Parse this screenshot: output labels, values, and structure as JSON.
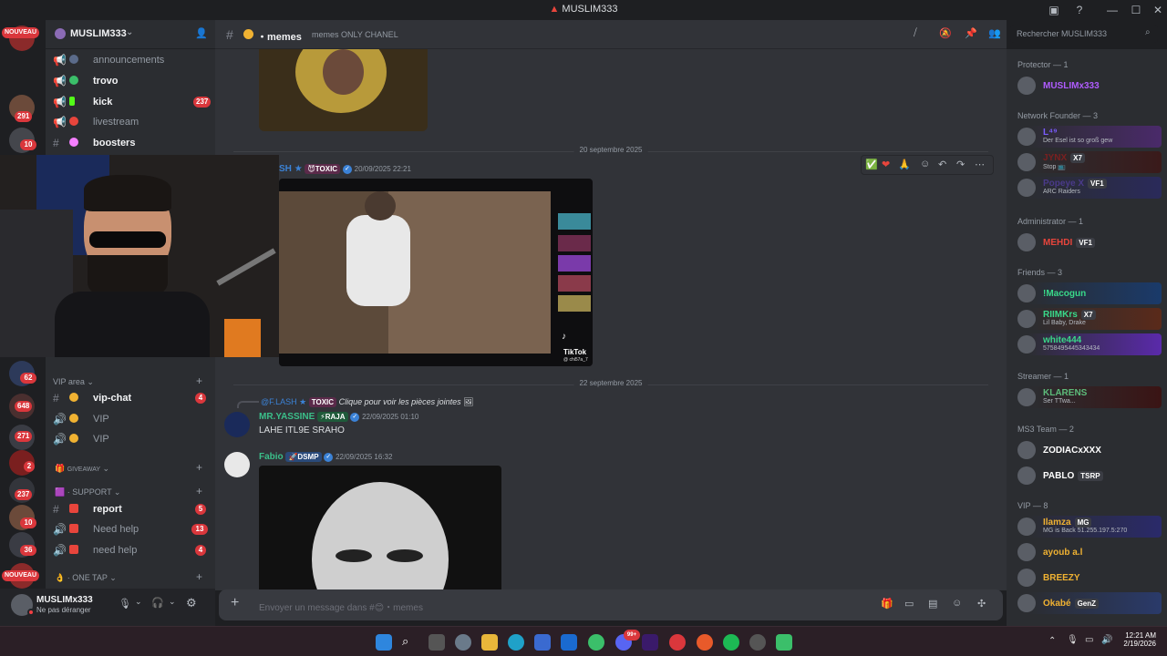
{
  "window": {
    "title": "MUSLIM333",
    "minimize": "—",
    "maximize": "☐",
    "close": "✕"
  },
  "rail": {
    "new_label": "NOUVEAU",
    "badges": [
      "291",
      "10",
      "62",
      "648",
      "271",
      "2",
      "237",
      "10",
      "36"
    ]
  },
  "server": {
    "name": "MUSLIM333"
  },
  "channels": [
    {
      "name": "announcements",
      "icon": "megaphone-icon"
    },
    {
      "name": "trovo",
      "icon": "hash-icon"
    },
    {
      "name": "kick",
      "icon": "megaphone-icon",
      "badge": "237"
    },
    {
      "name": "livestream",
      "icon": "megaphone-icon"
    },
    {
      "name": "boosters",
      "icon": "hash-icon"
    }
  ],
  "vip_area": {
    "label": "VIP area",
    "channels": [
      {
        "name": "vip-chat",
        "badge": "4"
      },
      {
        "name": "VIP"
      },
      {
        "name": "VIP"
      }
    ]
  },
  "giveaway_label": "GIVEAWAY",
  "support": {
    "label": "SUPPORT",
    "channels": [
      {
        "name": "report",
        "badge": "5"
      },
      {
        "name": "Need help",
        "badge": "13"
      },
      {
        "name": "need help",
        "badge": "4"
      }
    ]
  },
  "one_tap_label": "ONE TAP",
  "user": {
    "name": "MUSLIMx333",
    "status": "Ne pas déranger"
  },
  "chat_header": {
    "channel": "memes",
    "topic": "memes ONLY CHANEL",
    "search_placeholder": "Rechercher MUSLIM333"
  },
  "messages": {
    "date1": "20 septembre 2025",
    "msg1": {
      "author": "SH",
      "tag": "TOXIC",
      "time": "20/09/2025 22:21",
      "tiktok_label": "TikTok",
      "tiktok_handle": "@ chi57a_7"
    },
    "date2": "22 septembre 2025",
    "reply": {
      "author": "@F.LASH",
      "tag": "TOXIC",
      "text": "Clique pour voir les pièces jointes"
    },
    "msg2": {
      "author": "MR.YASSINE",
      "tag": "RAJA",
      "time": "22/09/2025 01:10",
      "text": "LAHE ITL9E SRAHO"
    },
    "msg3": {
      "author": "Fabio",
      "tag": "DSMP",
      "time": "22/09/2025 16:32"
    }
  },
  "composer": {
    "placeholder": "Envoyer un message dans #😊・memes"
  },
  "members": {
    "protector": {
      "label": "Protector — 1",
      "items": [
        {
          "name": "MUSLIMx333",
          "color": "#b05cff"
        }
      ]
    },
    "founder": {
      "label": "Network Founder — 3",
      "items": [
        {
          "name": "L⁴⁹",
          "sub": "Der Esel ist so groß gew",
          "color": "#7a5cff"
        },
        {
          "name": "JYNX",
          "tag": "X7",
          "sub": "Stop 📺",
          "color": "#7a2020"
        },
        {
          "name": "Popeye X",
          "tag": "VF1",
          "sub": "ARC Raiders",
          "color": "#4a3a8a"
        }
      ]
    },
    "admin": {
      "label": "Administrator — 1",
      "items": [
        {
          "name": "MEHDI",
          "tag": "VF1",
          "color": "#e8453c"
        }
      ]
    },
    "friends": {
      "label": "Friends — 3",
      "items": [
        {
          "name": "!Macogun",
          "color": "#39d98a"
        },
        {
          "name": "RIIMKrs",
          "tag": "X7",
          "sub": "Lil Baby, Drake",
          "color": "#39d98a"
        },
        {
          "name": "white444",
          "sub": "5758495445343434",
          "color": "#39d98a"
        }
      ]
    },
    "streamer": {
      "label": "Streamer — 1",
      "items": [
        {
          "name": "KLARENS",
          "sub": "Ser TTwa...",
          "color": "#5dbb7a"
        }
      ]
    },
    "team": {
      "label": "MS3 Team — 2",
      "items": [
        {
          "name": "ZODIACxXXX",
          "color": "#ffffff"
        },
        {
          "name": "PABLO",
          "tag": "TSRP",
          "color": "#ffffff"
        }
      ]
    },
    "vip": {
      "label": "VIP — 8",
      "items": [
        {
          "name": "Ilamza",
          "tag": "MG",
          "sub": "MG is Back 51.255.197.5:270",
          "color": "#f0b232"
        },
        {
          "name": "ayoub a.l",
          "color": "#f0b232"
        },
        {
          "name": "BREEZY",
          "color": "#f0b232"
        },
        {
          "name": "Okabé",
          "tag": "GenZ",
          "color": "#f0b232"
        }
      ]
    }
  },
  "taskbar": {
    "time": "12:21 AM",
    "date": "2/19/2026",
    "discord_badge": "99+"
  },
  "colors": {
    "accent": "#5865f2",
    "badge": "#da373c",
    "bg": "#313338"
  }
}
